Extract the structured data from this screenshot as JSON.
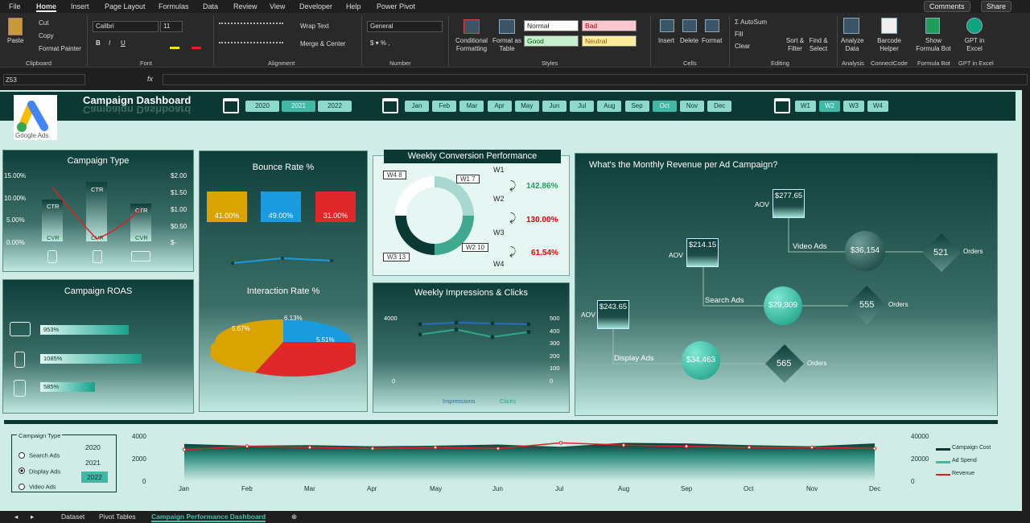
{
  "menu": {
    "tabs": [
      "File",
      "Home",
      "Insert",
      "Page Layout",
      "Formulas",
      "Data",
      "Review",
      "View",
      "Developer",
      "Help",
      "Power Pivot"
    ],
    "active": "Home",
    "comments": "Comments",
    "share": "Share"
  },
  "ribbon": {
    "clipboard": {
      "paste": "Paste",
      "cut": "Cut",
      "copy": "Copy",
      "format_painter": "Format Painter",
      "label": "Clipboard"
    },
    "font": {
      "name": "Calibri",
      "size": "11",
      "bold": "B",
      "italic": "I",
      "underline": "U",
      "label": "Font"
    },
    "alignment": {
      "wrap": "Wrap Text",
      "merge": "Merge & Center",
      "label": "Alignment"
    },
    "number": {
      "format": "General",
      "label": "Number"
    },
    "styles": {
      "cond": "Conditional Formatting",
      "table": "Format as Table",
      "normal": "Normal",
      "bad": "Bad",
      "good": "Good",
      "neutral": "Neutral",
      "label": "Styles"
    },
    "cells": {
      "insert": "Insert",
      "delete": "Delete",
      "format": "Format",
      "label": "Cells"
    },
    "editing": {
      "autosum": "AutoSum",
      "fill": "Fill",
      "clear": "Clear",
      "sort": "Sort & Filter",
      "find": "Find & Select",
      "label": "Editing"
    },
    "analysis": {
      "analyze": "Analyze Data",
      "label": "Analysis"
    },
    "connectcode": {
      "barcode": "Barcode Helper",
      "label": "ConnectCode"
    },
    "formulabot": {
      "show": "Show Formula Bot",
      "label": "Formula Bot"
    },
    "gpt": {
      "gpt": "GPT in Excel",
      "label": "GPT in Excel"
    }
  },
  "formula_bar": {
    "cell": "Z53",
    "fx": "fx"
  },
  "dashboard": {
    "title": "Campaign Dashboard",
    "logo_text": "Google Ads",
    "years": [
      "2020",
      "2021",
      "2022"
    ],
    "year_selected": "2021",
    "months": [
      "Jan",
      "Feb",
      "Mar",
      "Apr",
      "May",
      "Jun",
      "Jul",
      "Aug",
      "Sep",
      "Oct",
      "Nov",
      "Dec"
    ],
    "month_selected": "Oct",
    "weeks": [
      "W1",
      "W2",
      "W3",
      "W4"
    ],
    "week_selected": "W2",
    "campaign_type": {
      "title": "Campaign Type",
      "left_axis": [
        "15.00%",
        "10.00%",
        "5.00%",
        "0.00%"
      ],
      "right_axis": [
        "$2.00",
        "$1.50",
        "$1.00",
        "$0.50",
        "$-"
      ],
      "ctr": "CTR",
      "cvr": "CVR"
    },
    "roas": {
      "title": "Campaign ROAS",
      "items": [
        {
          "icon": "video",
          "value": "953%",
          "pct": 0.55
        },
        {
          "icon": "mobile",
          "value": "1085%",
          "pct": 0.63
        },
        {
          "icon": "search",
          "value": "585%",
          "pct": 0.34
        }
      ]
    },
    "bounce": {
      "title": "Bounce Rate %",
      "cards": [
        {
          "value": "41.00%",
          "color": "#d9a400"
        },
        {
          "value": "49.00%",
          "color": "#1a9be0"
        },
        {
          "value": "31.00%",
          "color": "#e0282a"
        }
      ]
    },
    "interaction": {
      "title": "Interaction Rate %",
      "slices": [
        {
          "value": "5.67%",
          "color": "#d9a400"
        },
        {
          "value": "6.13%",
          "color": "#1a9be0"
        },
        {
          "value": "5.51%",
          "color": "#e0282a"
        }
      ]
    },
    "weekly_conv": {
      "title": "Weekly Conversion Performance",
      "labels": [
        "W4 8",
        "W1 7",
        "W2 10",
        "W3 13"
      ],
      "weeks": [
        "W1",
        "W2",
        "W3",
        "W4"
      ],
      "changes": [
        {
          "value": "142.86%",
          "color": "#1fa05a"
        },
        {
          "value": "130.00%",
          "color": "#d00"
        },
        {
          "value": "61.54%",
          "color": "#d00"
        }
      ]
    },
    "impressions": {
      "title": "Weekly Impressions & Clicks",
      "left_axis": [
        "4000",
        "0"
      ],
      "right_axis": [
        "500",
        "400",
        "300",
        "200",
        "100",
        "0"
      ],
      "legend": [
        "Impressions",
        "Clicks"
      ]
    },
    "revenue": {
      "title": "What's the Monthly Revenue per Ad Campaign?",
      "campaigns": [
        {
          "name": "Video Ads",
          "aov": "$277.65",
          "revenue": "$36,154",
          "orders": "521"
        },
        {
          "name": "Search Ads",
          "aov": "$214.15",
          "revenue": "$29,809",
          "orders": "555"
        },
        {
          "name": "Display Ads",
          "aov": "$243.65",
          "revenue": "$34,463",
          "orders": "565"
        }
      ],
      "aov_label": "AOV",
      "orders_label": "Orders"
    },
    "filter": {
      "title": "Campaign Type",
      "options": [
        "Search Ads",
        "Display Ads",
        "Video Ads"
      ],
      "selected": "Display Ads",
      "years": [
        "2020",
        "2021",
        "2022"
      ],
      "year_selected": "2022"
    },
    "trend": {
      "months": [
        "Jan",
        "Feb",
        "Mar",
        "Apr",
        "May",
        "Jun",
        "Jul",
        "Aug",
        "Sep",
        "Oct",
        "Nov",
        "Dec"
      ],
      "left_axis": [
        "4000",
        "2000",
        "0"
      ],
      "right_axis": [
        "40000",
        "20000",
        "0"
      ],
      "legend": [
        "Campaign Cost",
        "Ad Spend",
        "Revenue"
      ]
    }
  },
  "chart_data": [
    {
      "type": "line",
      "title": "Weekly Impressions & Clicks",
      "categories": [
        "W1",
        "W2",
        "W3",
        "W4"
      ],
      "series": [
        {
          "name": "Impressions",
          "values": [
            3900,
            4000,
            3950,
            3900
          ]
        },
        {
          "name": "Clicks",
          "values": [
            380,
            420,
            360,
            400
          ]
        }
      ]
    },
    {
      "type": "area",
      "categories": [
        "Jan",
        "Feb",
        "Mar",
        "Apr",
        "May",
        "Jun",
        "Jul",
        "Aug",
        "Sep",
        "Oct",
        "Nov",
        "Dec"
      ],
      "series": [
        {
          "name": "Campaign Cost",
          "values": [
            3300,
            3150,
            3200,
            3100,
            3150,
            3250,
            3050,
            3400,
            3350,
            3200,
            3100,
            3350
          ]
        },
        {
          "name": "Revenue",
          "values": [
            2800,
            3100,
            3000,
            2900,
            3000,
            2900,
            3400,
            3200,
            3100,
            3000,
            3000,
            2900
          ]
        }
      ]
    }
  ]
}
